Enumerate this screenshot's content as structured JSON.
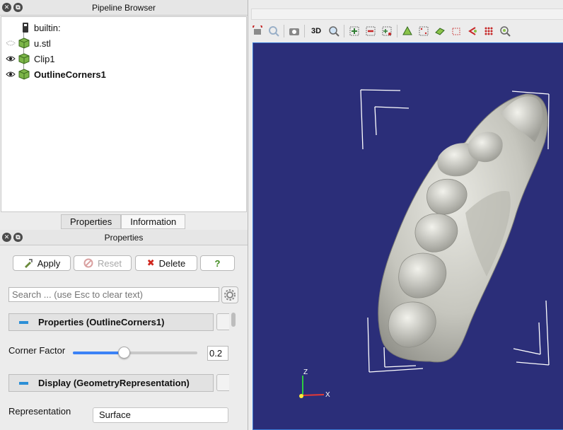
{
  "pipeline_browser": {
    "title": "Pipeline Browser",
    "items": [
      {
        "label": "builtin:",
        "bold": false
      },
      {
        "label": "u.stl",
        "bold": false
      },
      {
        "label": "Clip1",
        "bold": false
      },
      {
        "label": "OutlineCorners1",
        "bold": true
      }
    ]
  },
  "tabs": [
    "Properties",
    "Information"
  ],
  "properties_panel": {
    "title": "Properties",
    "apply_label": "Apply",
    "reset_label": "Reset",
    "delete_label": "Delete",
    "help_label": "?",
    "search_placeholder": "Search ... (use Esc to clear text)",
    "section_properties": "Properties (OutlineCorners1)",
    "corner_factor_label": "Corner Factor",
    "corner_factor_value": "0.2",
    "corner_factor_fraction": 0.41,
    "section_display": "Display (GeometryRepresentation)",
    "representation_label": "Representation",
    "representation_value": "Surface"
  },
  "toolbar": {
    "icons": [
      "reset-camera-icon",
      "zoom-closest-icon",
      "camera-icon",
      "3d-toggle",
      "zoom-to-box-icon",
      "select-cells-on-icon",
      "select-points-on-icon",
      "select-cells-with-polygon-icon",
      "select-cells-frustum-icon",
      "select-points-frustum-icon",
      "interactive-select-icon",
      "hover-points-icon",
      "grow-selection-icon",
      "find-data-icon"
    ],
    "mode_3d": "3D"
  },
  "viewport": {
    "background": "#2b2e79",
    "axes": {
      "z": "Z",
      "x": "X"
    }
  },
  "colors": {
    "accent": "#3b82f6",
    "section_minus": "#2c8fd6",
    "delete_red": "#d0261d",
    "cube_green": "#7cb548"
  }
}
